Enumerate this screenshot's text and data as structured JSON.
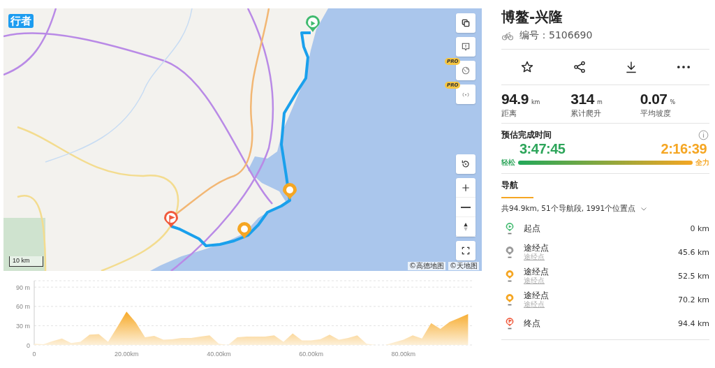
{
  "map": {
    "logo": "行者",
    "scale": "10 km",
    "attribution": [
      "©高德地图",
      "©天地图"
    ],
    "controls": [
      {
        "kind": "layers"
      },
      {
        "kind": "feedback"
      },
      {
        "kind": "globe",
        "badge": "PRO"
      },
      {
        "kind": "signal",
        "badge": "PRO"
      }
    ]
  },
  "elevation": {
    "chart_data": {
      "type": "area",
      "x": [
        0,
        2,
        4,
        6,
        8,
        10,
        12,
        14,
        16,
        18,
        20,
        22,
        24,
        26,
        28,
        30,
        32,
        34,
        36,
        38,
        40,
        42,
        44,
        46,
        48,
        50,
        52,
        54,
        56,
        58,
        60,
        62,
        64,
        66,
        68,
        70,
        72,
        74,
        76,
        78,
        80,
        82,
        84,
        86,
        88,
        90,
        92,
        94
      ],
      "values": [
        2,
        1,
        6,
        10,
        3,
        5,
        16,
        17,
        5,
        28,
        52,
        35,
        12,
        14,
        8,
        9,
        11,
        11,
        13,
        15,
        2,
        0,
        12,
        13,
        13,
        13,
        15,
        5,
        18,
        7,
        7,
        9,
        16,
        8,
        11,
        15,
        2,
        0,
        0,
        4,
        8,
        15,
        10,
        34,
        25,
        36,
        42,
        48
      ],
      "xlim": [
        0,
        95
      ],
      "ylim": [
        0,
        100
      ],
      "grid": true,
      "xticks": [
        0,
        {
          "value": 20,
          "label": "20.00km"
        },
        {
          "value": 40,
          "label": "40.00km"
        },
        {
          "value": 60,
          "label": "60.00km"
        },
        {
          "value": 80,
          "label": "80.00km"
        }
      ],
      "yticks": [
        0,
        {
          "value": 30,
          "label": "30 m"
        },
        {
          "value": 60,
          "label": "60 m"
        },
        {
          "value": 90,
          "label": "90 m"
        }
      ]
    }
  },
  "route": {
    "title": "博鳌-兴隆",
    "number": "编号：5106690"
  },
  "stats": [
    {
      "value": "94.9",
      "unit": "km",
      "label": "距离"
    },
    {
      "value": "314",
      "unit": "m",
      "label": "累计爬升"
    },
    {
      "value": "0.07",
      "unit": "%",
      "label": "平均坡度"
    }
  ],
  "estimate": {
    "title": "预估完成时间",
    "easy_time": "3:47:45",
    "hard_time": "2:16:39",
    "easy_label": "轻松",
    "hard_label": "全力"
  },
  "tabs": [
    {
      "label": "导航",
      "selected": true
    }
  ],
  "summary": "共94.9km, 51个导航段, 1991个位置点",
  "waypoints": [
    {
      "kind": "start",
      "color": "#3fba6e",
      "name": "起点",
      "distance": "0 km"
    },
    {
      "kind": "waypoint",
      "color": "#9a9a9a",
      "name": "途经点",
      "subtitle": "途经点",
      "distance": "45.6 km"
    },
    {
      "kind": "waypoint",
      "color": "#f5a623",
      "name": "途经点",
      "subtitle": "途经点",
      "distance": "52.5 km"
    },
    {
      "kind": "waypoint",
      "color": "#f5a623",
      "name": "途经点",
      "subtitle": "途经点",
      "distance": "70.2 km"
    },
    {
      "kind": "end",
      "color": "#f05a3c",
      "name": "终点",
      "distance": "94.4 km"
    }
  ]
}
